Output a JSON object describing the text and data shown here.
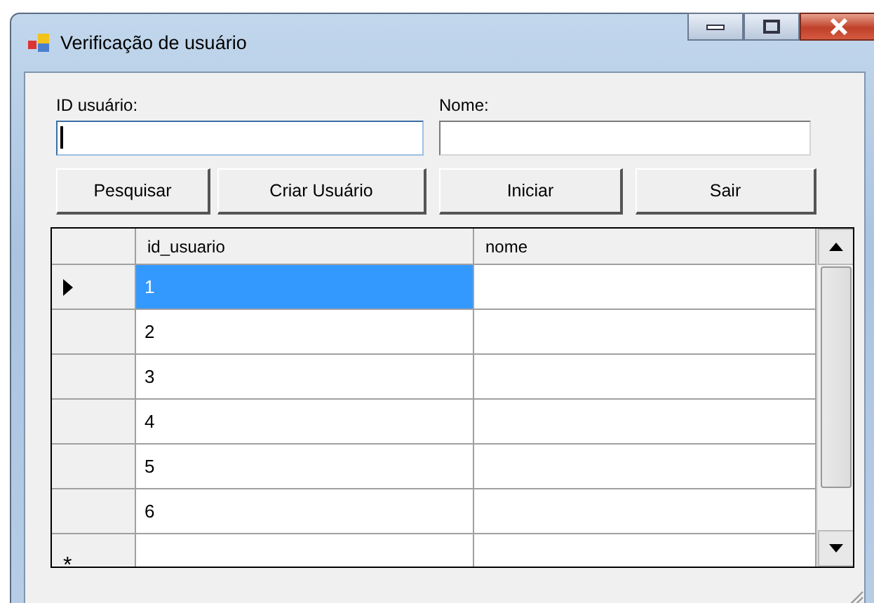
{
  "window": {
    "title": "Verificação de usuário"
  },
  "fields": [
    {
      "label": "ID usuário:",
      "focused": true
    },
    {
      "label": "Nome:",
      "focused": false
    }
  ],
  "buttons": [
    "Pesquisar",
    "Criar Usuário",
    "Iniciar",
    "Sair"
  ],
  "table": {
    "columns": [
      "id_usuario",
      "nome"
    ],
    "rows": [
      {
        "id_usuario": "1",
        "selected": true
      },
      {
        "id_usuario": "2",
        "selected": false
      },
      {
        "id_usuario": "3",
        "selected": false
      },
      {
        "id_usuario": "4",
        "selected": false
      },
      {
        "id_usuario": "5",
        "selected": false
      },
      {
        "id_usuario": "6",
        "selected": false
      }
    ],
    "new_row_marker": "*"
  }
}
